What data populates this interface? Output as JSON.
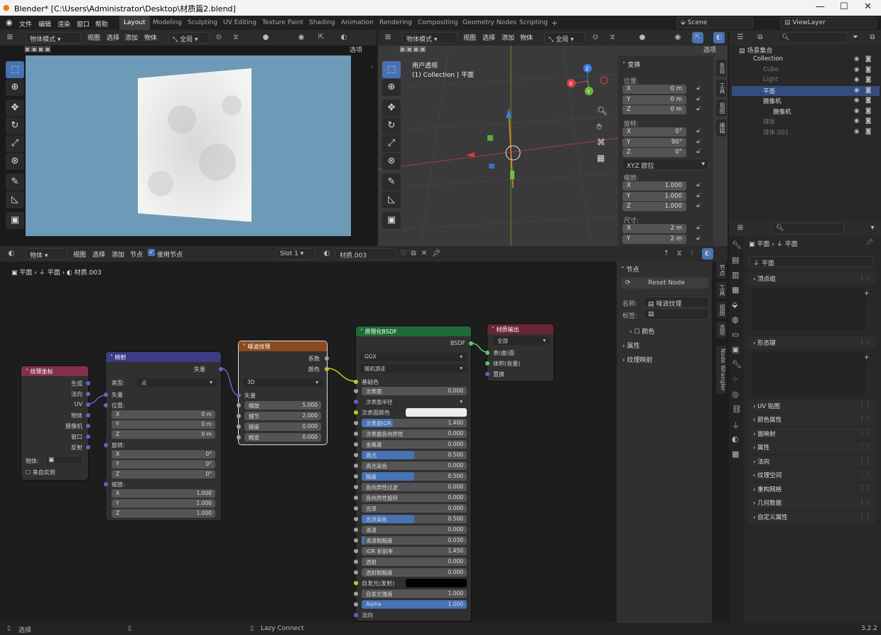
{
  "window": {
    "title": "Blender* [C:\\Users\\Administrator\\Desktop\\材质篇2.blend]"
  },
  "menu": [
    "文件",
    "编辑",
    "渲染",
    "窗口",
    "帮助"
  ],
  "workspaces": [
    "Layout",
    "Modeling",
    "Sculpting",
    "UV Editing",
    "Texture Paint",
    "Shading",
    "Animation",
    "Rendering",
    "Compositing",
    "Geometry Nodes",
    "Scripting"
  ],
  "scene": "Scene",
  "viewlayer": "ViewLayer",
  "left_view": {
    "mode": "物体模式",
    "menus": [
      "视图",
      "选择",
      "添加",
      "物体"
    ],
    "transform": "全局",
    "options": "选项"
  },
  "right_view": {
    "mode": "物体模式",
    "menus": [
      "视图",
      "选择",
      "添加",
      "物体"
    ],
    "transform": "全局",
    "options": "选项",
    "info1": "用户透视",
    "info2": "(1) Collection | 平面"
  },
  "transform_panel": {
    "title": "变换",
    "loc_label": "位置:",
    "loc": [
      [
        "X",
        "0 m"
      ],
      [
        "Y",
        "0 m"
      ],
      [
        "Z",
        "0 m"
      ]
    ],
    "rot_label": "旋转:",
    "rot": [
      [
        "X",
        "0°"
      ],
      [
        "Y",
        "90°"
      ],
      [
        "Z",
        "0°"
      ]
    ],
    "rot_mode": "XYZ 欧拉",
    "scale_label": "缩放:",
    "scale": [
      [
        "X",
        "1.000"
      ],
      [
        "Y",
        "1.000"
      ],
      [
        "Z",
        "1.000"
      ]
    ],
    "dim_label": "尺寸:",
    "dim": [
      [
        "X",
        "2 m"
      ],
      [
        "Y",
        "2 m"
      ]
    ]
  },
  "npanel_tabs": [
    "条目",
    "工具",
    "视图",
    "编辑"
  ],
  "outliner": {
    "root": "场景集合",
    "items": [
      {
        "name": "Collection",
        "indent": 0
      },
      {
        "name": "Cube",
        "indent": 1
      },
      {
        "name": "Light",
        "indent": 1
      },
      {
        "name": "平面",
        "indent": 1
      },
      {
        "name": "摄像机",
        "indent": 1
      },
      {
        "name": "摄像机",
        "indent": 2
      },
      {
        "name": "球体",
        "indent": 1
      },
      {
        "name": "球体.001",
        "indent": 1
      }
    ]
  },
  "node_editor": {
    "type": "物体",
    "menus": [
      "视图",
      "选择",
      "添加",
      "节点"
    ],
    "use_nodes": "使用节点",
    "slot": "Slot 1",
    "material": "材质.003",
    "breadcrumb": [
      "平面",
      "平面",
      "材质.003"
    ]
  },
  "nodes": {
    "texcoord": {
      "title": "纹理坐标",
      "outputs": [
        "生成",
        "法向",
        "UV",
        "物体",
        "摄像机",
        "窗口",
        "反射"
      ],
      "object_label": "物体:",
      "instancer": "来自实例"
    },
    "mapping": {
      "title": "映射",
      "out": "矢量",
      "type_label": "类型:",
      "type": "点",
      "vector": "矢量",
      "loc_label": "位置:",
      "loc": [
        [
          "X",
          "0 m"
        ],
        [
          "Y",
          "0 m"
        ],
        [
          "Z",
          "0 m"
        ]
      ],
      "rot_label": "旋转:",
      "rot": [
        [
          "X",
          "0°"
        ],
        [
          "Y",
          "0°"
        ],
        [
          "Z",
          "0°"
        ]
      ],
      "scale_label": "缩放:",
      "scale": [
        [
          "X",
          "1.000"
        ],
        [
          "Y",
          "1.000"
        ],
        [
          "Z",
          "1.000"
        ]
      ]
    },
    "noise": {
      "title": "噪波纹理",
      "outputs": [
        "系数",
        "颜色"
      ],
      "dim": "3D",
      "vector": "矢量",
      "fields": [
        [
          "缩放",
          "5.000"
        ],
        [
          "细节",
          "2.000"
        ],
        [
          "糙度",
          "0.000"
        ],
        [
          "畸变",
          "0.000"
        ]
      ]
    },
    "bsdf": {
      "title": "原理化BSDF",
      "out": "BSDF",
      "dist": "GGX",
      "sss": "随机游走",
      "base": "基础色",
      "fields": [
        [
          "次表面",
          "0.000",
          0
        ],
        [
          "次表面半径",
          "",
          0
        ],
        [
          "次表面颜色",
          "",
          0
        ],
        [
          "次表面IOR",
          "1.400",
          0.3
        ],
        [
          "次表面各向异性",
          "0.000",
          0
        ],
        [
          "金属度",
          "0.000",
          0
        ],
        [
          "高光",
          "0.500",
          0.5
        ],
        [
          "高光染色",
          "0.000",
          0
        ],
        [
          "糙度",
          "0.500",
          0.5
        ],
        [
          "各向异性过滤",
          "0.000",
          0
        ],
        [
          "各向异性旋转",
          "0.000",
          0
        ],
        [
          "光泽",
          "0.000",
          0
        ],
        [
          "光泽染色",
          "0.500",
          0.5
        ],
        [
          "清漆",
          "0.000",
          0
        ],
        [
          "清漆粗糙度",
          "0.030",
          0.03
        ],
        [
          "IOR 折射率",
          "1.450",
          0
        ],
        [
          "透射",
          "0.000",
          0
        ],
        [
          "透射粗糙度",
          "0.000",
          0
        ],
        [
          "自发光(发射)",
          "",
          0
        ],
        [
          "自发光强度",
          "1.000",
          0
        ],
        [
          "Alpha",
          "1.000",
          1
        ]
      ],
      "normal": "法向"
    },
    "output": {
      "title": "材质输出",
      "target": "全部",
      "inputs": [
        "表(曲)面",
        "体积(音量)",
        "置换"
      ]
    }
  },
  "node_panel": {
    "title": "节点",
    "reset": "Reset Node",
    "name_label": "名称:",
    "name": "噪波纹理",
    "label_label": "标签:",
    "color": "颜色",
    "props": "属性",
    "texmap": "纹理映射",
    "tabs": [
      "节点",
      "工具",
      "视图",
      "选项",
      "Node Wrangler"
    ]
  },
  "props": {
    "obj": "平面",
    "data": "平面",
    "mesh": "平面",
    "sections": [
      "顶点组",
      "形态键",
      "UV 贴图",
      "颜色属性",
      "面映射",
      "属性",
      "法向",
      "纹理空间",
      "重构网格",
      "几何数据",
      "自定义属性"
    ]
  },
  "status": {
    "left": "选择",
    "mid": "Lazy Connect",
    "version": "3.2.2"
  }
}
